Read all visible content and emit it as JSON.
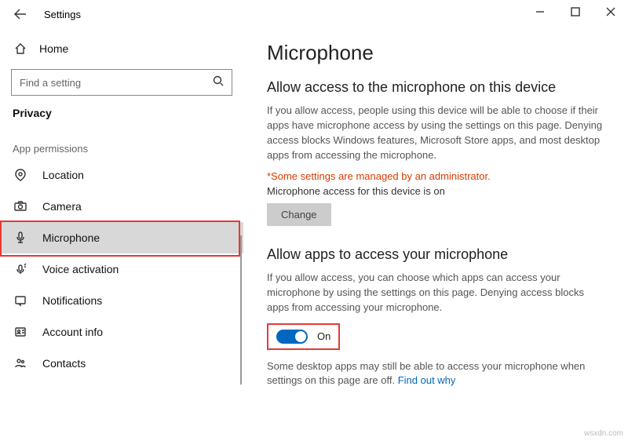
{
  "titlebar": {
    "title": "Settings"
  },
  "sidebar": {
    "home": "Home",
    "search_placeholder": "Find a setting",
    "category": "Privacy",
    "section": "App permissions",
    "items": [
      {
        "label": "Location"
      },
      {
        "label": "Camera"
      },
      {
        "label": "Microphone"
      },
      {
        "label": "Voice activation"
      },
      {
        "label": "Notifications"
      },
      {
        "label": "Account info"
      },
      {
        "label": "Contacts"
      }
    ]
  },
  "main": {
    "title": "Microphone",
    "section1": {
      "heading": "Allow access to the microphone on this device",
      "desc": "If you allow access, people using this device will be able to choose if their apps have microphone access by using the settings on this page. Denying access blocks Windows features, Microsoft Store apps, and most desktop apps from accessing the microphone.",
      "admin_note": "*Some settings are managed by an administrator.",
      "access_status": "Microphone access for this device is on",
      "change_btn": "Change"
    },
    "section2": {
      "heading": "Allow apps to access your microphone",
      "desc": "If you allow access, you can choose which apps can access your microphone by using the settings on this page. Denying access blocks apps from accessing your microphone.",
      "toggle_state": "On",
      "footer": "Some desktop apps may still be able to access your microphone when settings on this page are off. ",
      "footer_link": "Find out why"
    }
  },
  "watermark": "wsxdn.com"
}
